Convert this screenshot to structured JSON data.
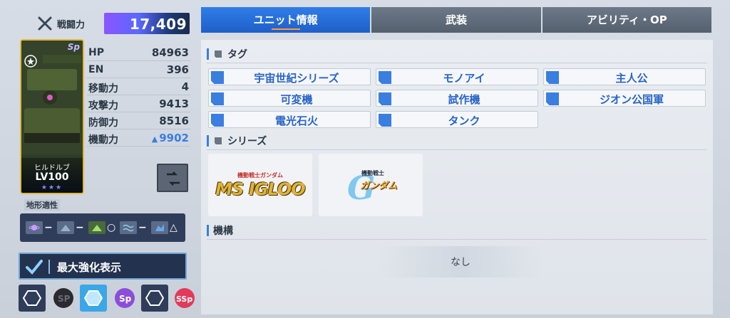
{
  "power": {
    "label": "戦闘力",
    "value": "17,409"
  },
  "unit": {
    "name": "ヒルドルブ",
    "level": "LV100",
    "stars": "★★★",
    "badge": "Sp"
  },
  "stats": [
    {
      "label": "HP",
      "value": "84963",
      "boosted": false
    },
    {
      "label": "EN",
      "value": "396",
      "boosted": false
    },
    {
      "label": "移動力",
      "value": "4",
      "boosted": false
    },
    {
      "label": "攻撃力",
      "value": "9413",
      "boosted": false
    },
    {
      "label": "防御力",
      "value": "8516",
      "boosted": false
    },
    {
      "label": "機動力",
      "value": "9902",
      "boosted": true
    }
  ],
  "terrain": {
    "label": "地形適性",
    "items": [
      {
        "icon": "space-icon",
        "grade": "−"
      },
      {
        "icon": "air-icon",
        "grade": "−"
      },
      {
        "icon": "ground-icon",
        "grade": "○"
      },
      {
        "icon": "water-icon",
        "grade": "−"
      },
      {
        "icon": "underwater-icon",
        "grade": "△"
      }
    ]
  },
  "max_display": {
    "label": "最大強化表示",
    "checked": true
  },
  "tabs": [
    {
      "label": "ユニット情報",
      "active": true
    },
    {
      "label": "武装",
      "active": false
    },
    {
      "label": "アビリティ・OP",
      "active": false
    }
  ],
  "sections": {
    "tags": {
      "title": "タグ",
      "items": [
        "宇宙世紀シリーズ",
        "モノアイ",
        "主人公",
        "可変機",
        "試作機",
        "ジオン公国軍",
        "電光石火",
        "タンク"
      ]
    },
    "series": {
      "title": "シリーズ",
      "cards": [
        {
          "sub": "機動戦士ガンダム",
          "main": "MS IGLOO"
        },
        {
          "sub": "機動戦士",
          "main": "ガンダム"
        }
      ]
    },
    "mechanism": {
      "title": "機構",
      "empty": "なし"
    }
  },
  "colors": {
    "accent": "#3a7ee0",
    "tab_active": "#1f5fc9",
    "tag_text": "#2864c8",
    "gold": "#e1b83a"
  }
}
